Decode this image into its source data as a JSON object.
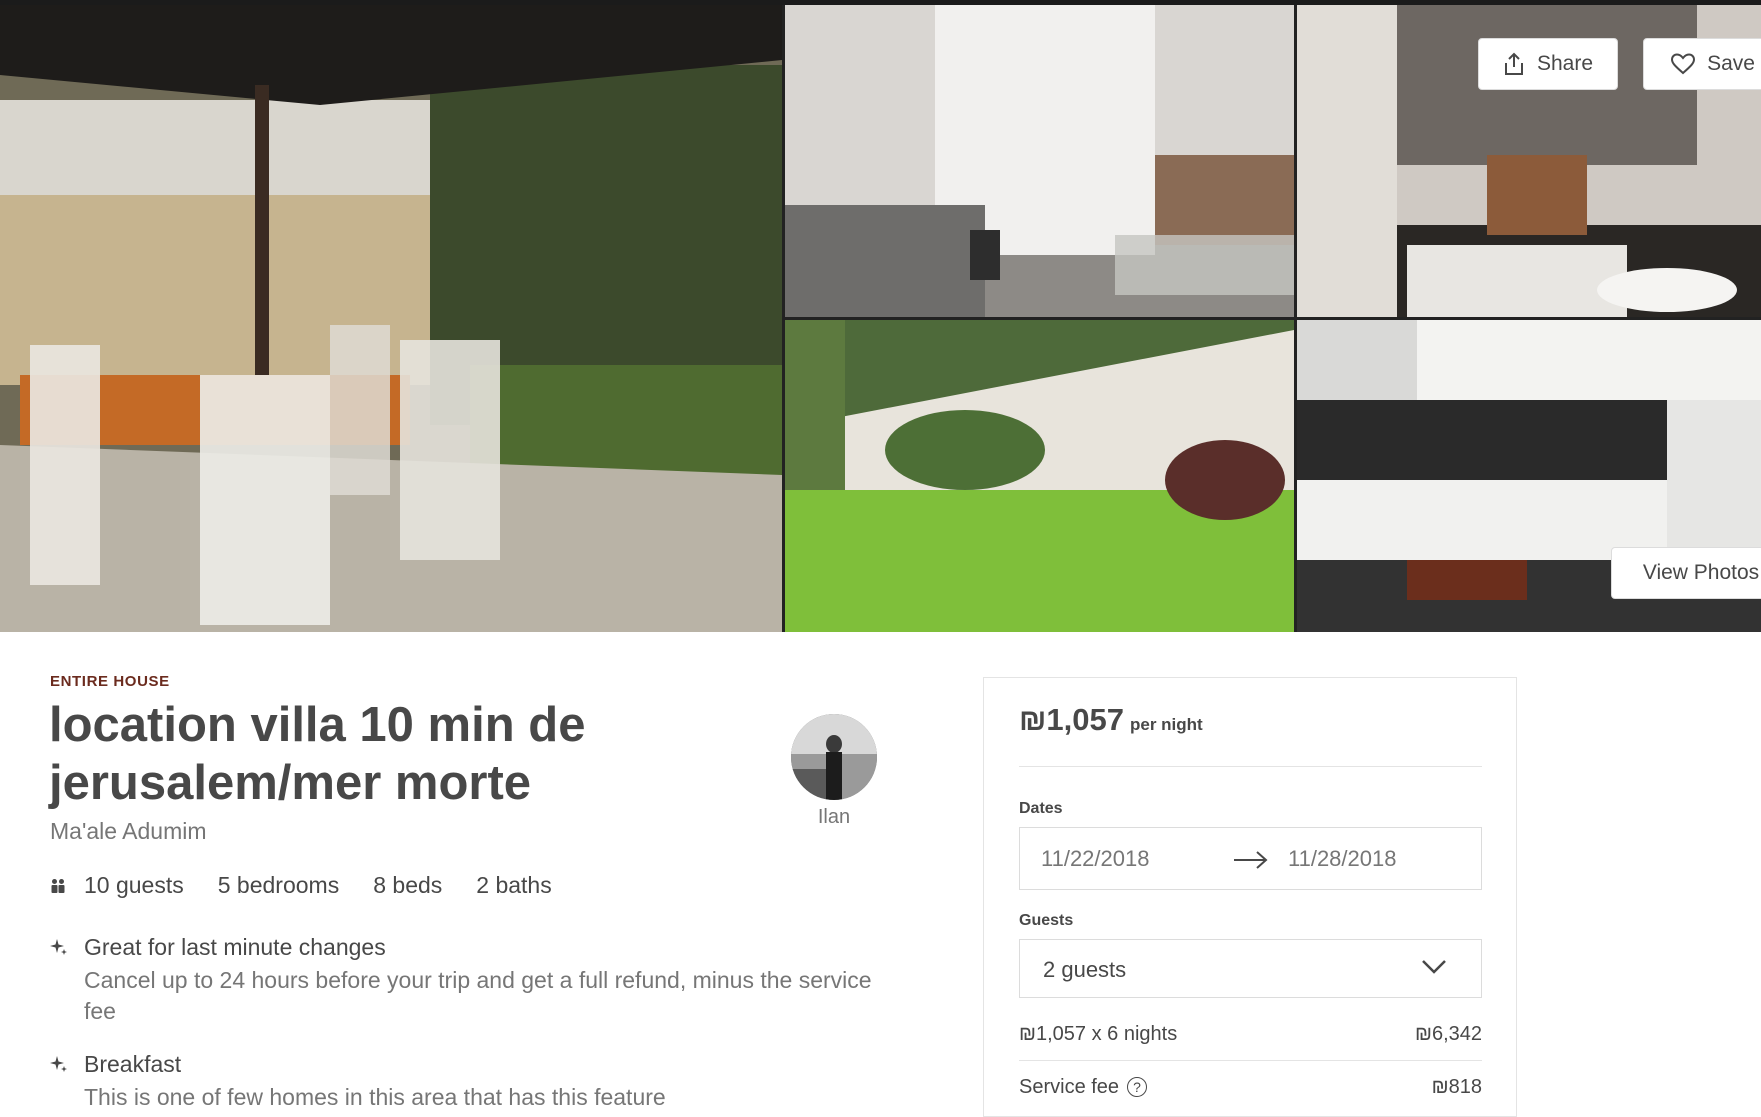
{
  "gallery": {
    "photos": [
      {
        "name": "patio-dining-photo"
      },
      {
        "name": "living-room-photo"
      },
      {
        "name": "bathroom-photo"
      },
      {
        "name": "garden-photo"
      },
      {
        "name": "kitchen-photo"
      }
    ],
    "share_label": "Share",
    "save_label": "Save",
    "view_photos_label": "View Photos"
  },
  "listing": {
    "kind": "ENTIRE HOUSE",
    "title": "location villa 10 min de jerusalem/mer morte",
    "location": "Ma'ale Adumim",
    "host_name": "Ilan",
    "stats": {
      "guests": "10 guests",
      "bedrooms": "5 bedrooms",
      "beds": "8 beds",
      "baths": "2 baths"
    },
    "features": [
      {
        "title": "Great for last minute changes",
        "description": "Cancel up to 24 hours before your trip and get a full refund, minus the service fee"
      },
      {
        "title": "Breakfast",
        "description": "This is one of few homes in this area that has this feature"
      }
    ]
  },
  "booking": {
    "price": "₪1,057",
    "per_night": "per night",
    "dates_label": "Dates",
    "check_in": "11/22/2018",
    "check_out": "11/28/2018",
    "guests_label": "Guests",
    "guests_value": "2 guests",
    "line_nights": "₪1,057 x 6 nights",
    "line_nights_total": "₪6,342",
    "service_fee_label": "Service fee",
    "service_fee_help": "?",
    "service_fee_total": "₪818"
  },
  "colors": {
    "text": "#484848",
    "muted": "#767676",
    "kind_label": "#6b2b1e",
    "border": "#e4e4e4"
  }
}
